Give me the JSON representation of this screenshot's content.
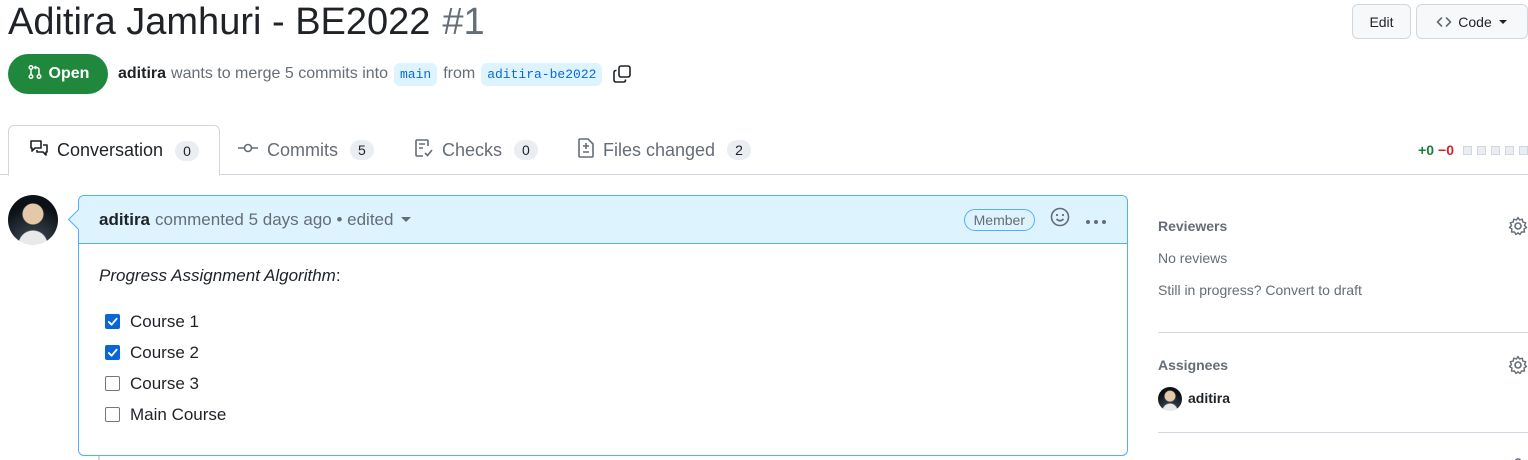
{
  "pr": {
    "title": "Aditira Jamhuri - BE2022",
    "number": "#1",
    "state": "Open",
    "author": "aditira",
    "merge_text": "wants to merge 5 commits into",
    "base_branch": "main",
    "from_text": "from",
    "head_branch": "aditira-be2022"
  },
  "header_buttons": {
    "edit": "Edit",
    "code": "Code"
  },
  "tabs": [
    {
      "label": "Conversation",
      "count": "0"
    },
    {
      "label": "Commits",
      "count": "5"
    },
    {
      "label": "Checks",
      "count": "0"
    },
    {
      "label": "Files changed",
      "count": "2"
    }
  ],
  "diffstat": {
    "additions": "+0",
    "deletions": "−0"
  },
  "comment": {
    "author": "aditira",
    "meta": "commented 5 days ago • edited",
    "badge": "Member",
    "intro": "Progress Assignment Algorithm",
    "intro_suffix": ":",
    "tasks": [
      {
        "label": "Course 1",
        "checked": true
      },
      {
        "label": "Course 2",
        "checked": true
      },
      {
        "label": "Course 3",
        "checked": false
      },
      {
        "label": "Main Course",
        "checked": false
      }
    ]
  },
  "sidebar": {
    "reviewers": {
      "title": "Reviewers",
      "empty": "No reviews",
      "draft_text": "Still in progress? Convert to draft"
    },
    "assignees": {
      "title": "Assignees",
      "user": "aditira"
    }
  },
  "colors": {
    "open_green": "#1f883d",
    "accent_blue": "#0969da",
    "comment_bg": "#ddf4ff",
    "comment_border": "#54aeff"
  }
}
